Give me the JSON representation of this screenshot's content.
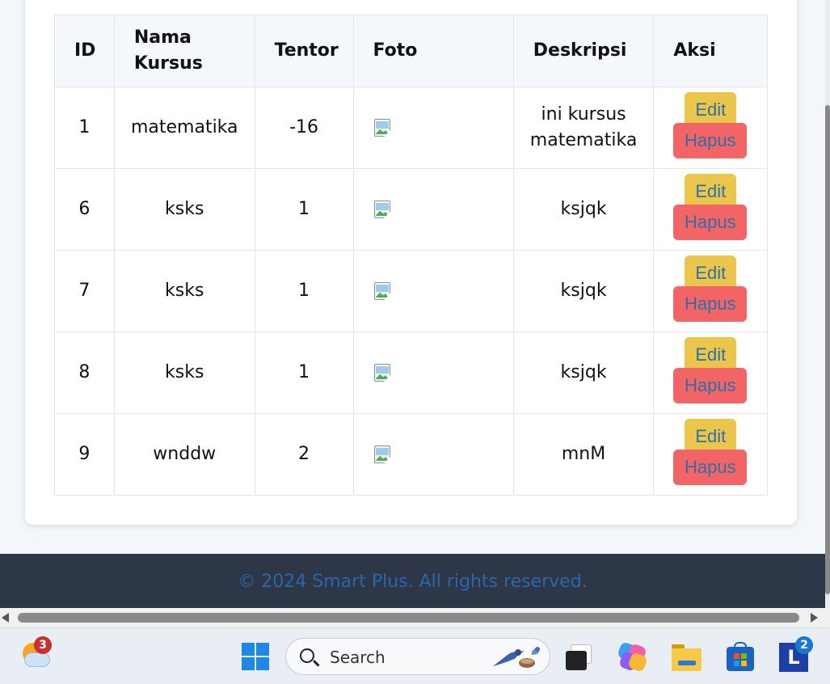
{
  "table": {
    "headers": [
      "ID",
      "Nama Kursus",
      "Tentor",
      "Foto",
      "Deskripsi",
      "Aksi"
    ],
    "rows": [
      {
        "id": "1",
        "nama": "matematika",
        "tentor": "-16",
        "deskripsi": "ini kursus matematika"
      },
      {
        "id": "6",
        "nama": "ksks",
        "tentor": "1",
        "deskripsi": "ksjqk"
      },
      {
        "id": "7",
        "nama": "ksks",
        "tentor": "1",
        "deskripsi": "ksjqk"
      },
      {
        "id": "8",
        "nama": "ksks",
        "tentor": "1",
        "deskripsi": "ksjqk"
      },
      {
        "id": "9",
        "nama": "wnddw",
        "tentor": "2",
        "deskripsi": "mnM"
      }
    ],
    "actions": {
      "edit_label": "Edit",
      "delete_label": "Hapus"
    }
  },
  "footer": {
    "text": "© 2024 Smart Plus. All rights reserved."
  },
  "taskbar": {
    "search_placeholder": "Search",
    "weather_badge": "3",
    "app_badge": "2",
    "app_letter": "L",
    "icons": [
      "weather-icon",
      "windows-start-icon",
      "search-icon",
      "task-view-icon",
      "copilot-icon",
      "file-explorer-icon",
      "microsoft-store-icon",
      "app-l-icon"
    ]
  },
  "colors": {
    "edit_button": "#eac74a",
    "delete_button": "#f26465",
    "button_text": "#2f6fa8",
    "footer_bg": "#2d3748",
    "footer_text": "#2b67a6"
  }
}
